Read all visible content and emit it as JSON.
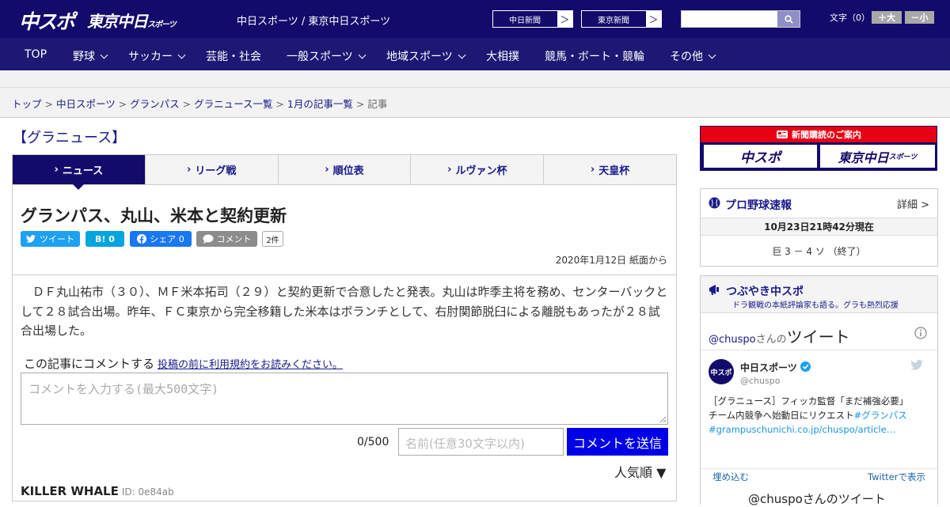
{
  "header": {
    "logo1": "中スポ",
    "logo2": "東京中日",
    "logo2_sub": "スポーツ",
    "site_names": "中日スポーツ / 東京中日スポーツ",
    "paper_btn1": "中日新聞",
    "paper_btn2": "東京新聞",
    "font_label": "文字（0）",
    "font_plus": "＋大",
    "font_minus": "－小",
    "arrow": "＞"
  },
  "nav": {
    "items": [
      "TOP",
      "野球",
      "サッカー",
      "芸能・社会",
      "一般スポーツ",
      "地域スポーツ",
      "大相撲",
      "競馬・ボート・競輪",
      "その他"
    ]
  },
  "breadcrumb": {
    "items": [
      "トップ",
      "中日スポーツ",
      "グランパス",
      "グラニュース一覧",
      "1月の記事一覧"
    ],
    "current": "記事",
    "sep": " > "
  },
  "section_title": "【グラニュース】",
  "tabs": [
    "ニュース",
    "リーグ戦",
    "順位表",
    "ルヴァン杯",
    "天皇杯"
  ],
  "tab_mark": "›",
  "article": {
    "title": "グランパス、丸山、米本と契約更新",
    "date": "2020年1月12日 紙面から",
    "body": "ＤＦ丸山祐市（３０）、ＭＦ米本拓司（２９）と契約更新で合意したと発表。丸山は昨季主将を務め、センターバックとして２８試合出場。昨年、ＦＣ東京から完全移籍した米本はボランチとして、右肘関節脱臼による離脱もあったが２８試合出場した。"
  },
  "share": {
    "tweet": "ツイート",
    "hatena": "B! 0",
    "facebook": "シェア 0",
    "comment": "コメント",
    "comment_count": "2件"
  },
  "comments": {
    "label": "この記事にコメントする",
    "terms_link": "投稿の前に利用規約をお読みください。",
    "placeholder": "コメントを入力する(最大500文字)",
    "counter": "0/500",
    "name_placeholder": "名前(任意30文字以内)",
    "submit": "コメントを送信",
    "sort": "人気順 ▼",
    "first_author": "KILLER WHALE",
    "first_id": "ID: 0e84ab"
  },
  "sidebar": {
    "subs_title": "新聞購読のご案内",
    "subs_btn1": "中スポ",
    "subs_btn2": "東京中日",
    "subs_btn2_sub": "スポーツ",
    "baseball": {
      "title": "プロ野球速報",
      "detail": "詳細 >",
      "time": "10月23日21時42分現在",
      "score": "巨 3 － 4 ソ （終了）"
    },
    "tweets": {
      "title": "つぶやき中スポ",
      "subtitle": "ドラ観戦の本紙評論家も語る。グラも熱烈応援",
      "header_user": "@chuspo",
      "header_suffix": "さんの",
      "header_big": "ツイート",
      "author": "中日スポーツ",
      "handle": "@chuspo",
      "avatar_text": "中スポ",
      "text1": "［グラニュース］フィッカ監督「まだ補強必要」",
      "text2": "チーム内競争へ始動日にリクエスト",
      "tag1": "#グランパス",
      "link": "#grampuschunichi.co.jp/chuspo/article…",
      "embed": "埋め込む",
      "view_on_twitter": "Twitterで表示",
      "footer": "@chuspoさんのツイート"
    }
  },
  "colors": {
    "navy": "#130b6b",
    "nav": "#1c1873",
    "link": "#1a1a8c",
    "submit": "#0000e6",
    "twitter": "#1da1f2",
    "hatena": "#00a4de",
    "facebook": "#1877f2",
    "comment_btn": "#8c8c8c",
    "subs_red": "#e60012"
  }
}
